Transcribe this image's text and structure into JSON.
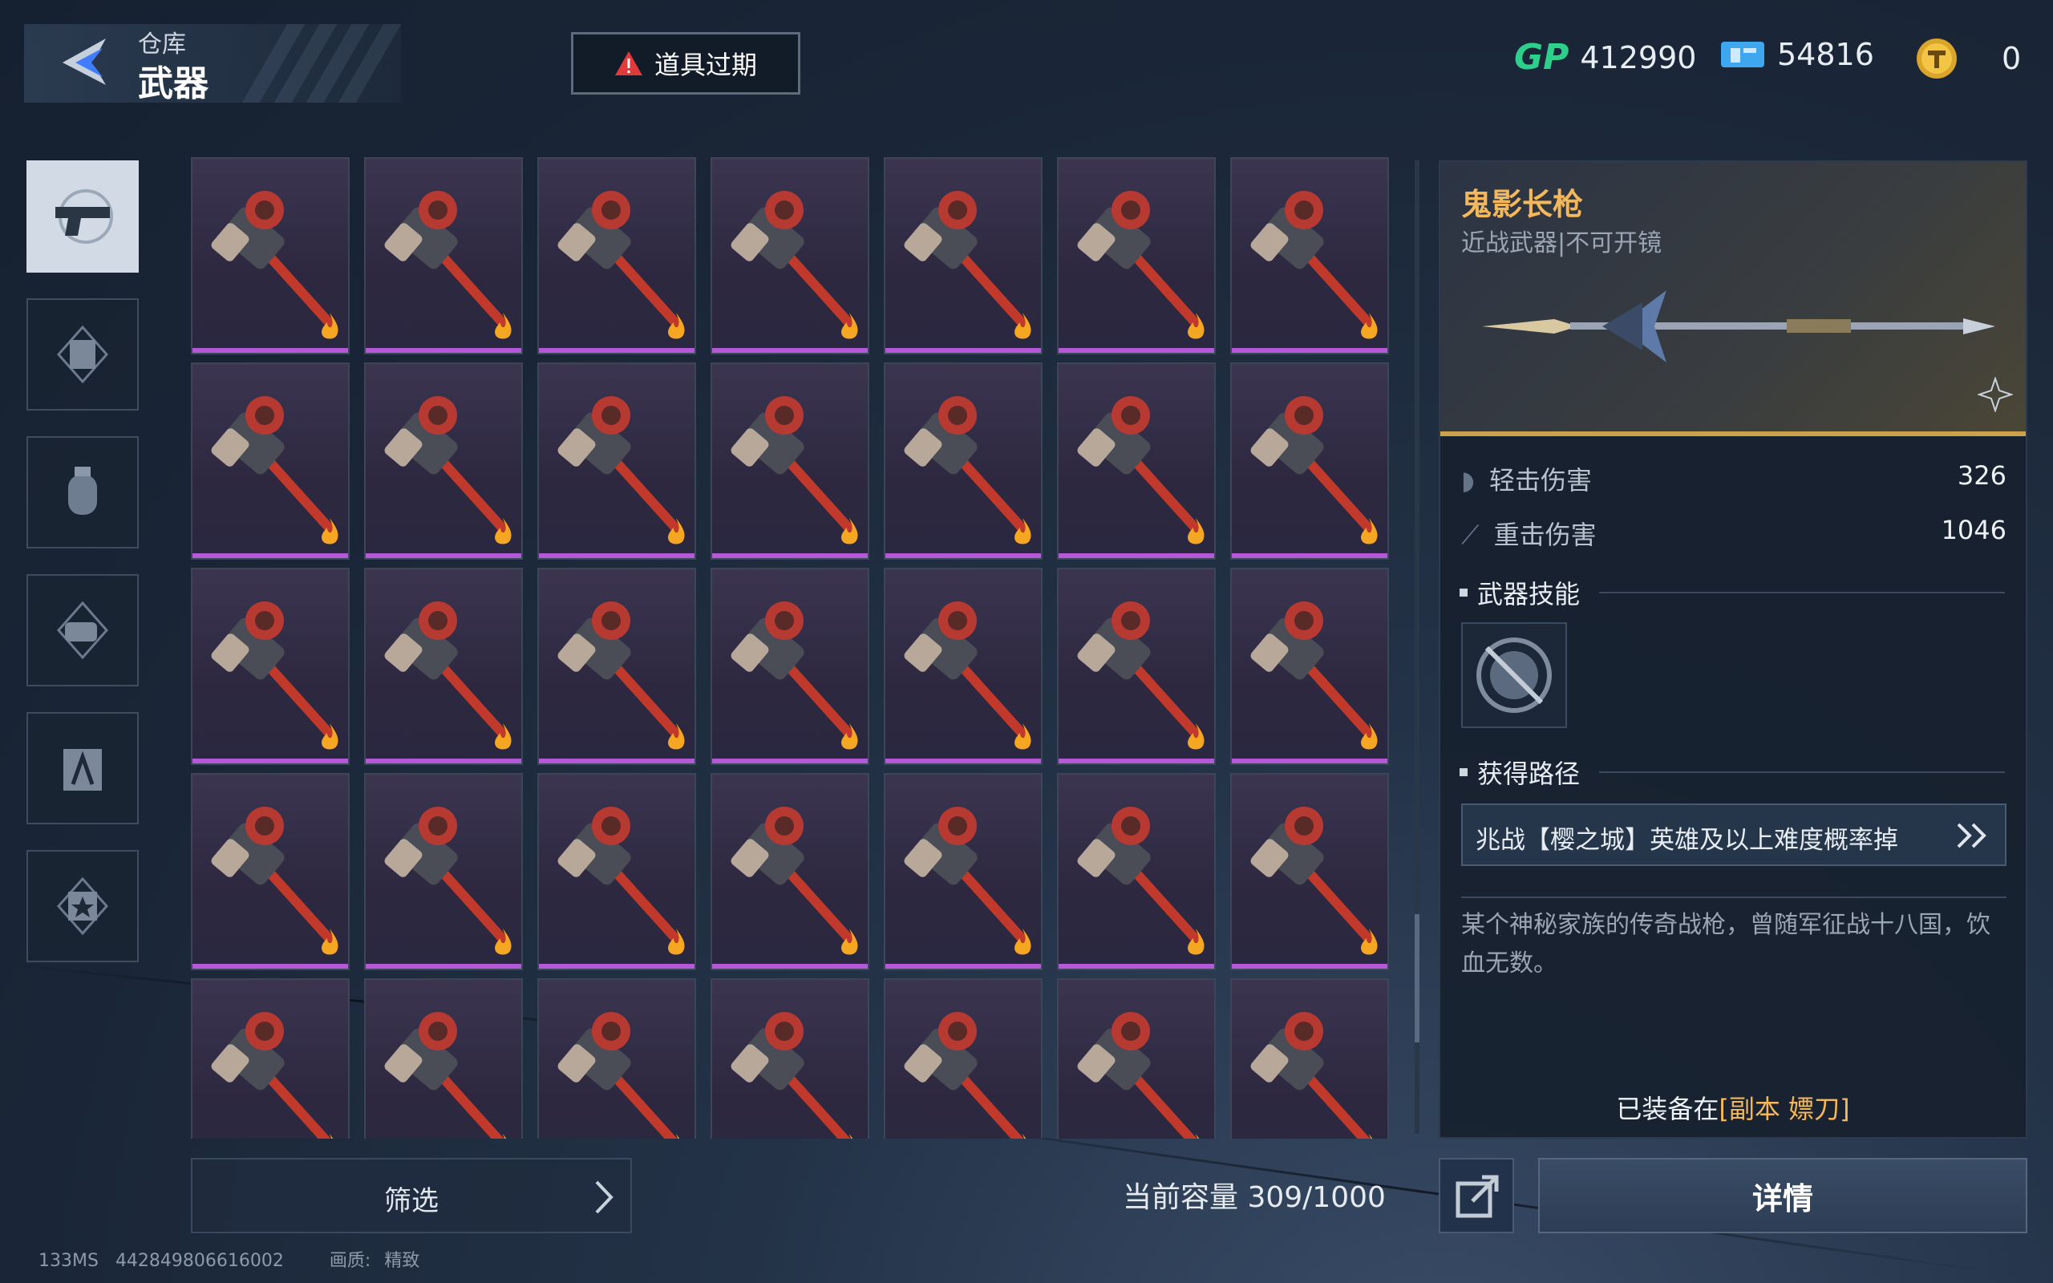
{
  "header": {
    "breadcrumb": "仓库",
    "title": "武器",
    "expire_button": "道具过期",
    "currencies": [
      {
        "icon": "gp-icon",
        "value": "412990"
      },
      {
        "icon": "ticket-icon",
        "value": "54816"
      },
      {
        "icon": "coin-icon",
        "value": "0"
      }
    ]
  },
  "tabs": [
    {
      "icon": "pistol-icon",
      "active": true
    },
    {
      "icon": "armor-icon",
      "active": false
    },
    {
      "icon": "grenade-icon",
      "active": false
    },
    {
      "icon": "hand-icon",
      "active": false
    },
    {
      "icon": "compass-bag-icon",
      "active": false
    },
    {
      "icon": "star-badge-icon",
      "active": false
    }
  ],
  "inventory": {
    "item_icon": "hammer-icon",
    "badge_icon": "flame-icon",
    "rarity_color": "#b45ad8",
    "rows": 5,
    "cols": 7
  },
  "footer": {
    "filter_label": "筛选",
    "capacity_label": "当前容量 309/1000",
    "debug_ms": "133MS",
    "debug_id": "442849806616002",
    "quality_label": "画质:",
    "quality_value": "精致"
  },
  "detail": {
    "name": "鬼影长枪",
    "subtitle": "近战武器|不可开镜",
    "stats": [
      {
        "label": "轻击伤害",
        "value": "326"
      },
      {
        "label": "重击伤害",
        "value": "1046"
      }
    ],
    "skill_section": "武器技能",
    "route_section": "获得路径",
    "route_text": "兆战【樱之城】英雄及以上难度概率掉",
    "description": "某个神秘家族的传奇战枪，曾随军征战十八国，饮血无数。",
    "equipped_prefix": "已装备在",
    "equipped_target": "[副本 嫖刀]",
    "detail_button": "详情"
  }
}
